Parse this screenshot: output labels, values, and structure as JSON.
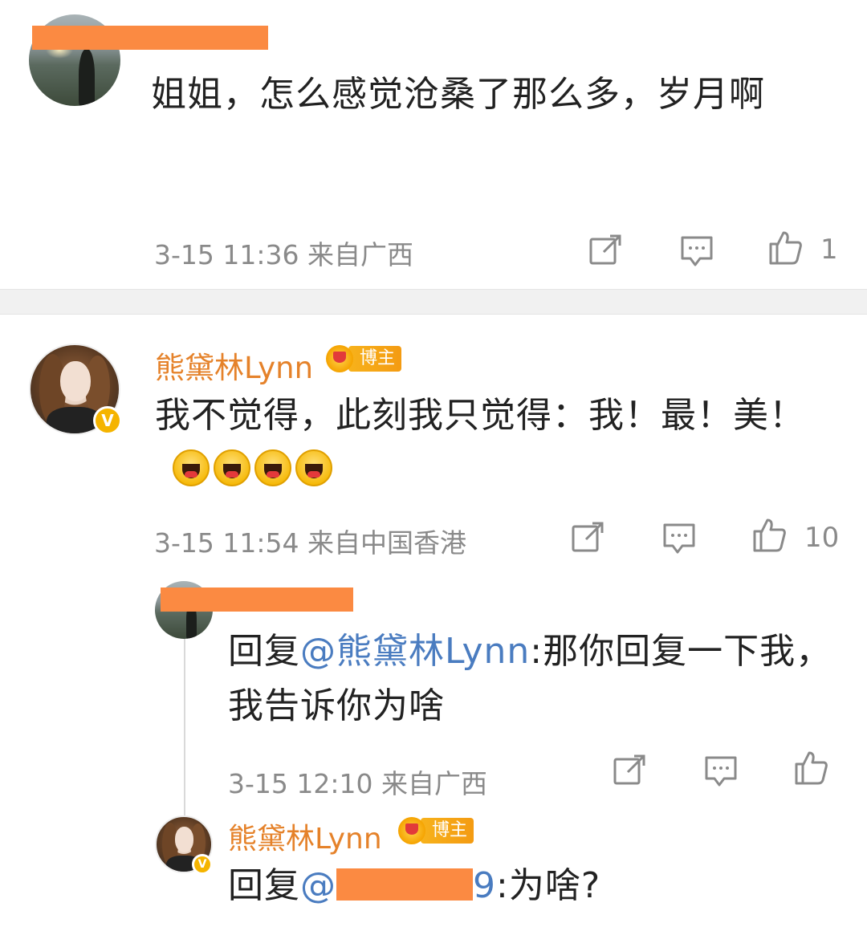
{
  "comments": [
    {
      "text": "姐姐，怎么感觉沧桑了那么多，岁月啊",
      "timestamp": "3-15 11:36",
      "location": "来自广西",
      "likes": "1"
    },
    {
      "author": "熊黛林Lynn",
      "badge": "博主",
      "verified": "V",
      "text": "我不觉得，此刻我只觉得：我！最！美！",
      "emoji": [
        "laughing-emoji",
        "laughing-emoji",
        "laughing-emoji",
        "laughing-emoji"
      ],
      "timestamp": "3-15 11:54",
      "location": "来自中国香港",
      "likes": "10"
    }
  ],
  "replies": [
    {
      "prefix": "回复",
      "mention": "@熊黛林Lynn",
      "text": ":那你回复一下我，我告诉你为啥",
      "timestamp": "3-15 12:10",
      "location": "来自广西"
    },
    {
      "author": "熊黛林Lynn",
      "badge": "博主",
      "verified": "V",
      "prefix": "回复",
      "mention_start": "@",
      "mention_end": "9",
      "text": ":为啥?"
    }
  ],
  "icons": {
    "repost": "share-icon",
    "comment": "comment-icon",
    "like": "thumbs-up-icon"
  },
  "colors": {
    "name": "#e5822a",
    "mention": "#4a7cc0",
    "meta": "#8a8a8a",
    "redaction": "#fb8a42",
    "badge": "#f5b400"
  }
}
